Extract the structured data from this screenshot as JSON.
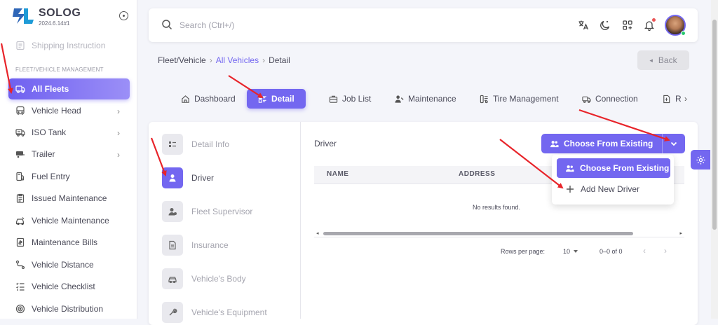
{
  "app": {
    "name": "SOLOG",
    "version": "2024.6.14#1"
  },
  "sidebar": {
    "faded_item": "Shipping Instruction",
    "section_title": "FLEET/VEHICLE MANAGEMENT",
    "items": [
      {
        "label": "All Fleets",
        "icon": "truck-icon",
        "active": true
      },
      {
        "label": "Vehicle Head",
        "icon": "bus-icon",
        "chevron": true
      },
      {
        "label": "ISO Tank",
        "icon": "tank-truck-icon",
        "chevron": true
      },
      {
        "label": "Trailer",
        "icon": "trailer-icon",
        "chevron": true
      },
      {
        "label": "Fuel Entry",
        "icon": "fuel-icon"
      },
      {
        "label": "Issued Maintenance",
        "icon": "clipboard-icon"
      },
      {
        "label": "Vehicle Maintenance",
        "icon": "car-wrench-icon"
      },
      {
        "label": "Maintenance Bills",
        "icon": "bill-icon"
      },
      {
        "label": "Vehicle Distance",
        "icon": "route-icon"
      },
      {
        "label": "Vehicle Checklist",
        "icon": "checklist-icon"
      },
      {
        "label": "Vehicle Distribution",
        "icon": "distribution-icon"
      }
    ]
  },
  "topbar": {
    "search_placeholder": "Search (Ctrl+/)"
  },
  "breadcrumb": {
    "part1": "Fleet/Vehicle",
    "part2": "All Vehicles",
    "part3": "Detail"
  },
  "back_label": "Back",
  "tabs": [
    {
      "label": "Dashboard",
      "icon": "home-icon"
    },
    {
      "label": "Detail",
      "icon": "list-details-icon",
      "active": true
    },
    {
      "label": "Job List",
      "icon": "briefcase-icon"
    },
    {
      "label": "Maintenance",
      "icon": "user-wrench-icon"
    },
    {
      "label": "Tire Management",
      "icon": "tire-icon"
    },
    {
      "label": "Connection",
      "icon": "truck-connection-icon"
    },
    {
      "label": "R",
      "icon": "receipt-icon"
    }
  ],
  "detail_menu": [
    {
      "label": "Detail Info",
      "icon": "info-list-icon"
    },
    {
      "label": "Driver",
      "icon": "user-icon",
      "active": true
    },
    {
      "label": "Fleet Supervisor",
      "icon": "supervisor-icon"
    },
    {
      "label": "Insurance",
      "icon": "document-icon"
    },
    {
      "label": "Vehicle's Body",
      "icon": "car-body-icon"
    },
    {
      "label": "Vehicle's Equipment",
      "icon": "wrench-icon"
    }
  ],
  "driver_panel": {
    "title": "Driver",
    "choose_button": "Choose From Existing",
    "columns": [
      "NAME",
      "ADDRESS"
    ],
    "empty_text": "No results found.",
    "rows_per_page_label": "Rows per page:",
    "rows_per_page": "10",
    "range": "0–0 of 0"
  },
  "dropdown": {
    "option1": "Choose From Existing",
    "option2": "Add New Driver"
  },
  "colors": {
    "accent": "#7367f0",
    "annotation": "#e8242a"
  }
}
